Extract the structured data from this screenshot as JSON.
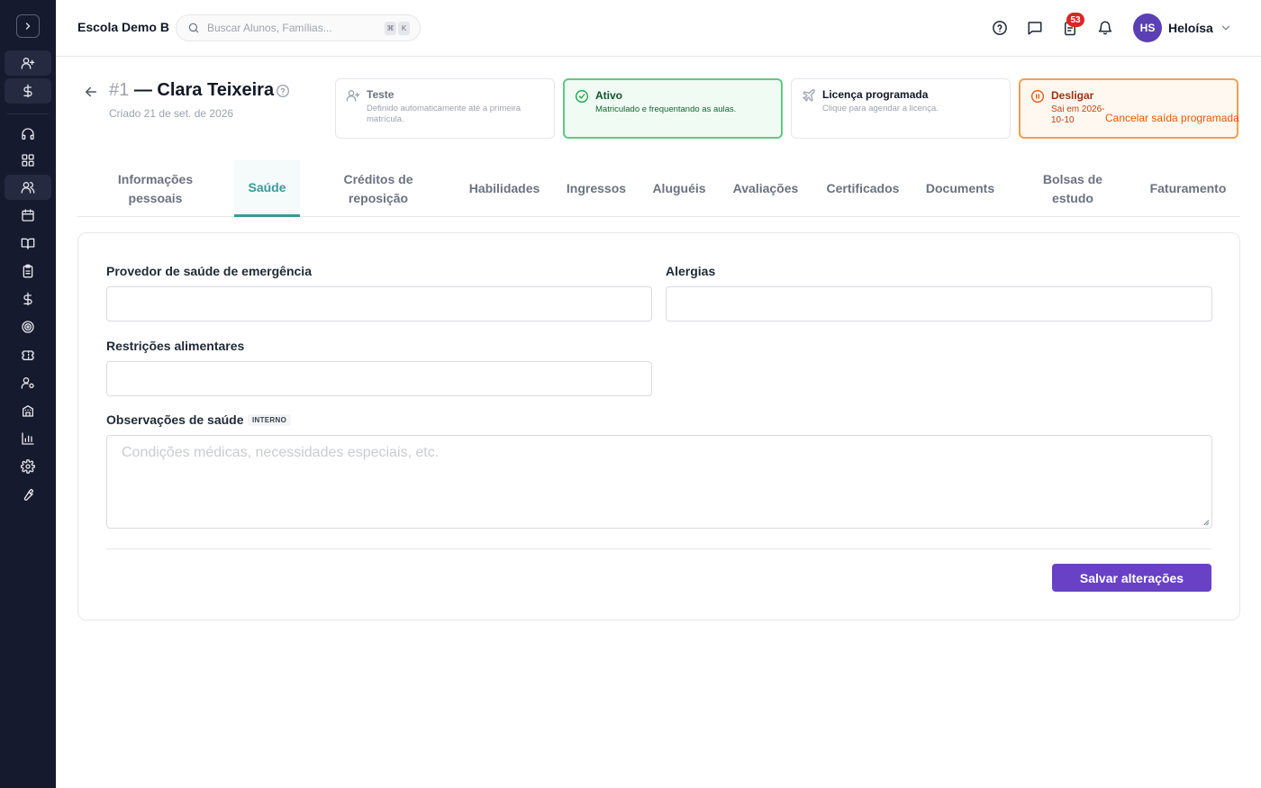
{
  "sidebar": {
    "items": [
      {
        "icon": "user-plus-icon"
      },
      {
        "icon": "dollar-icon"
      },
      {
        "icon": "headset-icon"
      },
      {
        "icon": "grid-icon"
      },
      {
        "icon": "users-icon"
      },
      {
        "icon": "calendar-icon"
      },
      {
        "icon": "book-open-icon"
      },
      {
        "icon": "clipboard-icon"
      },
      {
        "icon": "dollar-icon"
      },
      {
        "icon": "target-icon"
      },
      {
        "icon": "ticket-icon"
      },
      {
        "icon": "user-cog-icon"
      },
      {
        "icon": "building-icon"
      },
      {
        "icon": "bar-chart-icon"
      },
      {
        "icon": "settings-icon"
      },
      {
        "icon": "wrench-icon"
      }
    ]
  },
  "topbar": {
    "school_name": "Escola Demo B",
    "search_placeholder": "Buscar Alunos, Famílias...",
    "shortcut_key1": "⌘",
    "shortcut_key2": "K",
    "notifications_count": "53",
    "user_initials": "HS",
    "user_name": "Heloísa"
  },
  "header": {
    "student_number": "#1",
    "student_name": "— Clara Teixeira",
    "created": "Criado 21 de set. de 2026"
  },
  "statuses": [
    {
      "name": "Teste",
      "description": "Definido automaticamente até a primeira matrícula."
    },
    {
      "name": "Ativo",
      "description": "Matriculado e frequentando as aulas."
    },
    {
      "name": "Licença programada",
      "description": "Clique para agendar a licença."
    },
    {
      "name": "Desligar",
      "description": "Sai em 2026-10-10",
      "action": "Cancelar saída programada"
    }
  ],
  "tabs": [
    {
      "label": "Informações pessoais"
    },
    {
      "label": "Saúde"
    },
    {
      "label": "Créditos de reposição"
    },
    {
      "label": "Habilidades"
    },
    {
      "label": "Ingressos"
    },
    {
      "label": "Aluguéis"
    },
    {
      "label": "Avaliações"
    },
    {
      "label": "Certificados"
    },
    {
      "label": "Documents"
    },
    {
      "label": "Bolsas de estudo"
    },
    {
      "label": "Faturamento"
    }
  ],
  "active_tab": "Saúde",
  "form": {
    "emergency_provider_label": "Provedor de saúde de emergência",
    "emergency_provider_value": "",
    "allergies_label": "Alergias",
    "allergies_value": "",
    "dietary_label": "Restrições alimentares",
    "dietary_value": "",
    "notes_label": "Observações de saúde",
    "notes_tag": "INTERNO",
    "notes_placeholder": "Condições médicas, necessidades especiais, etc.",
    "notes_value": "",
    "save_label": "Salvar alterações"
  },
  "colors": {
    "sidebar_bg": "#161a2e",
    "accent_teal": "#3a9a9a",
    "primary_button": "#6941c6",
    "active_status": "#5fca85",
    "leave_status": "#f0a050",
    "badge": "#dc2626"
  }
}
